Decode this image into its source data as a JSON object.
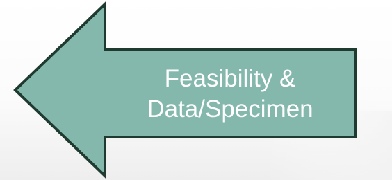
{
  "arrow": {
    "direction": "left",
    "fill_color": "#84b8ad",
    "stroke_color": "#1f3b30",
    "label_lines": [
      "Feasibility &",
      "Data/Specimen"
    ],
    "label_color": "#ffffff"
  }
}
